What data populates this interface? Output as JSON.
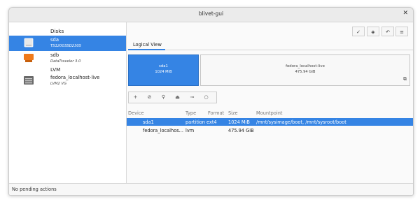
{
  "window": {
    "title": "blivet-gui"
  },
  "sidebar": {
    "disks_header": "Disks",
    "lvm_header": "LVM",
    "items": [
      {
        "name": "sda",
        "subtitle": "TS120GSSD230S",
        "icon": "harddisk-icon",
        "selected": true
      },
      {
        "name": "sdb",
        "subtitle": "DataTraveler 3.0",
        "icon": "usb-drive-icon",
        "selected": false
      },
      {
        "name": "fedora_localhost-live",
        "subtitle": "LVM2 VG",
        "icon": "volume-group-icon",
        "selected": false
      }
    ]
  },
  "toolbar": {
    "buttons": [
      {
        "icon": "apply-check-icon",
        "glyph": "✓"
      },
      {
        "icon": "clear-eraser-icon",
        "glyph": "◈"
      },
      {
        "icon": "undo-icon",
        "glyph": "↶"
      },
      {
        "icon": "menu-icon",
        "glyph": "≡"
      }
    ]
  },
  "tabs": {
    "logical_view": "Logical View"
  },
  "blocks": [
    {
      "name": "sda1",
      "size": "1024 MiB",
      "selected": true
    },
    {
      "name": "fedora_localhost-live",
      "size": "475.94 GiB",
      "selected": false
    }
  ],
  "actions": [
    {
      "icon": "add-icon",
      "glyph": "+"
    },
    {
      "icon": "delete-icon",
      "glyph": "⊘"
    },
    {
      "icon": "edit-icon",
      "glyph": "⚲"
    },
    {
      "icon": "unmount-icon",
      "glyph": "⏏"
    },
    {
      "icon": "decrypt-key-icon",
      "glyph": "⊸"
    },
    {
      "icon": "info-bulb-icon",
      "glyph": "○"
    }
  ],
  "list": {
    "headers": {
      "device": "Device",
      "type": "Type",
      "format": "Format",
      "size": "Size",
      "mountpoint": "Mountpoint"
    },
    "rows": [
      {
        "device": "sda1",
        "type": "partition",
        "format": "ext4",
        "size": "1024 MiB",
        "mountpoint": "/mnt/sysimage/boot, /mnt/sysroot/boot",
        "selected": true
      },
      {
        "device": "fedora_localhos...",
        "type": "lvm",
        "format": "",
        "size": "475.94 GiB",
        "mountpoint": "",
        "selected": false
      }
    ]
  },
  "status": {
    "text": "No pending actions"
  },
  "colors": {
    "accent": "#3584e4"
  }
}
